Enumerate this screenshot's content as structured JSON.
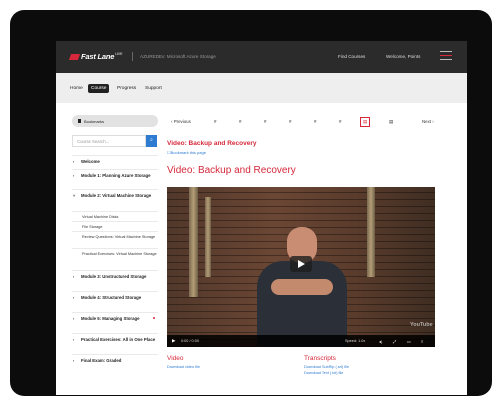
{
  "header": {
    "logo": "Fast Lane",
    "logo_sup": "LIVE",
    "course_code": "AZUREDEv: Microsoft Azure Storage",
    "find_courses": "Find Courses",
    "welcome": "Welcome, Points"
  },
  "tabs": [
    {
      "label": "Home"
    },
    {
      "label": "Course",
      "active": true
    },
    {
      "label": "Progress"
    },
    {
      "label": "Support"
    }
  ],
  "sidebar": {
    "bookmark_label": "Bookmarks",
    "search_placeholder": "Course Search...",
    "search_icon": "search-icon",
    "items": [
      {
        "label": "Welcome",
        "type": "module"
      },
      {
        "label": "Module 1: Planning Azure Storage",
        "type": "module"
      },
      {
        "label": "Module 2: Virtual Machine Storage",
        "type": "module",
        "expanded": true
      },
      {
        "label": "Virtual Machine Disks",
        "type": "sub"
      },
      {
        "label": "File Storage",
        "type": "sub"
      },
      {
        "label": "Review Questions: Virtual Machine Storage",
        "type": "sub"
      },
      {
        "label": "Practical Exercises: Virtual Machine Storage",
        "type": "sub"
      },
      {
        "label": "Module 3: Unstructured Storage",
        "type": "module"
      },
      {
        "label": "Module 4: Structured Storage",
        "type": "module"
      },
      {
        "label": "Module 5: Managing Storage",
        "type": "module",
        "dot": true
      },
      {
        "label": "Practical Exercises: All in One Place",
        "type": "module"
      },
      {
        "label": "Final Exam: Graded",
        "type": "module"
      }
    ]
  },
  "pager": {
    "prev": "Previous",
    "next": "Next",
    "items": [
      "#",
      "#",
      "#",
      "#",
      "#",
      "#",
      "#",
      "▤",
      "▤"
    ],
    "active_index": 7
  },
  "content": {
    "lesson_title": "Video: Backup and Recovery",
    "bookmark_link": "Bookmark this page",
    "page_title": "Video: Backup and Recovery"
  },
  "video": {
    "time": "0:00 / 0:00",
    "speed": "Speed: 1.0x",
    "youtube_label": "YouTube"
  },
  "downloads": {
    "video_heading": "Video",
    "video_link": "Download video file",
    "transcripts_heading": "Transcripts",
    "transcript_srt": "Download SubRip (.srt) file",
    "transcript_txt": "Download Text (.txt) file"
  }
}
